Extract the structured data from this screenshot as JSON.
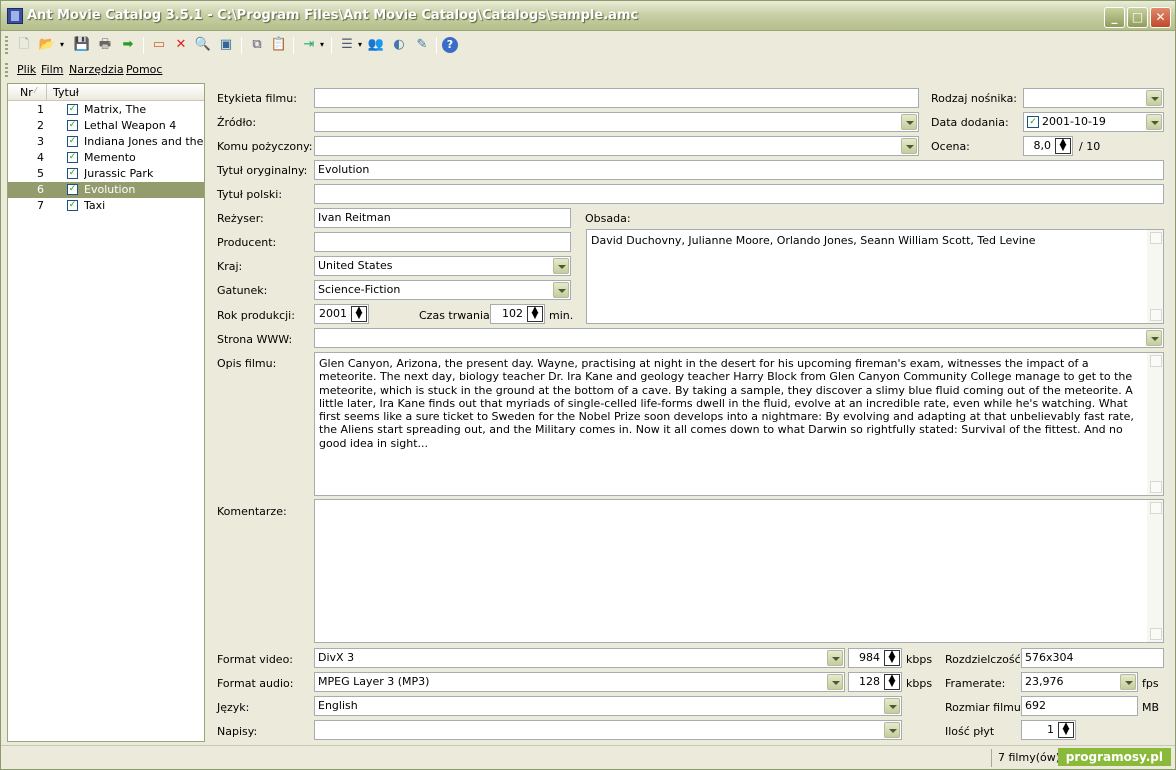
{
  "window": {
    "title": "Ant Movie Catalog 3.5.1 - C:\\Program Files\\Ant Movie Catalog\\Catalogs\\sample.amc"
  },
  "menu": [
    "Plik",
    "Film",
    "Narzędzia",
    "Pomoc"
  ],
  "list": {
    "header_nr": "Nr",
    "header_title": "Tytuł",
    "rows": [
      {
        "nr": "1",
        "title": "Matrix, The"
      },
      {
        "nr": "2",
        "title": "Lethal Weapon 4"
      },
      {
        "nr": "3",
        "title": "Indiana Jones and the..."
      },
      {
        "nr": "4",
        "title": "Memento"
      },
      {
        "nr": "5",
        "title": "Jurassic Park"
      },
      {
        "nr": "6",
        "title": "Evolution"
      },
      {
        "nr": "7",
        "title": "Taxi"
      }
    ],
    "selected_index": 5
  },
  "form": {
    "label_etykieta": "Etykieta filmu:",
    "value_etykieta": "",
    "label_zrodlo": "Źródło:",
    "value_zrodlo": "",
    "label_komu": "Komu pożyczony:",
    "value_komu": "",
    "label_tytul_oryg": "Tytuł oryginalny:",
    "value_tytul_oryg": "Evolution",
    "label_tytul_pol": "Tytuł polski:",
    "value_tytul_pol": "",
    "label_rezyser": "Reżyser:",
    "value_rezyser": "Ivan Reitman",
    "label_producent": "Producent:",
    "value_producent": "",
    "label_kraj": "Kraj:",
    "value_kraj": "United States",
    "label_gatunek": "Gatunek:",
    "value_gatunek": "Science-Fiction",
    "label_rok": "Rok produkcji:",
    "value_rok": "2001",
    "label_czas": "Czas trwania:",
    "value_czas": "102",
    "unit_min": "min.",
    "label_obsada": "Obsada:",
    "value_obsada": "David Duchovny, Julianne Moore, Orlando Jones, Seann William Scott, Ted Levine",
    "label_www": "Strona WWW:",
    "value_www": "",
    "label_opis": "Opis filmu:",
    "value_opis": "Glen Canyon, Arizona, the present day. Wayne, practising at night in the desert for his upcoming fireman's exam, witnesses the impact of a meteorite. The next day, biology teacher Dr. Ira Kane and geology teacher Harry Block from Glen Canyon Community College manage to get to the meteorite, which is stuck in the ground at the bottom of a cave. By taking a sample, they discover a slimy blue fluid coming out of the meteorite. A little later, Ira Kane finds out that myriads of single-celled life-forms dwell in the fluid, evolve at an incredible rate, even while he's watching. What first seems like a sure ticket to Sweden for the Nobel Prize soon develops into a nightmare: By evolving and adapting at that unbelievably fast rate, the Aliens start spreading out, and the Military comes in. Now it all comes down to what Darwin so rightfully stated: Survival of the fittest. And no good idea in sight...",
    "label_komentarze": "Komentarze:",
    "value_komentarze": "",
    "label_rodzaj": "Rodzaj nośnika:",
    "value_rodzaj": "",
    "label_data": "Data dodania:",
    "value_data": "2001-10-19",
    "label_ocena": "Ocena:",
    "value_ocena": "8,0",
    "unit_ocena": "/ 10",
    "label_format_video": "Format video:",
    "value_format_video": "DivX 3",
    "value_video_kbps": "984",
    "unit_kbps": "kbps",
    "label_format_audio": "Format audio:",
    "value_format_audio": "MPEG Layer 3 (MP3)",
    "value_audio_kbps": "128",
    "label_jezyk": "Język:",
    "value_jezyk": "English",
    "label_napisy": "Napisy:",
    "value_napisy": "",
    "label_rozdz": "Rozdzielczość:",
    "value_rozdz": "576x304",
    "label_framerate": "Framerate:",
    "value_framerate": "23,976",
    "unit_fps": "fps",
    "label_rozmiar": "Rozmiar filmu:",
    "value_rozmiar": "692",
    "unit_mb": "MB",
    "label_ilosc": "Ilość płyt",
    "value_ilosc": "1"
  },
  "status": {
    "count": "7 filmy(ów)",
    "badge": "programosy.pl"
  }
}
